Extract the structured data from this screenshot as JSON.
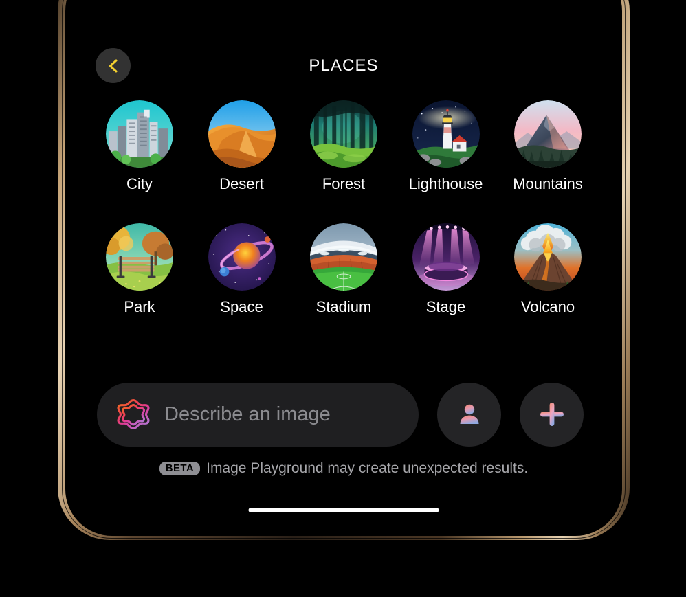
{
  "device": {
    "frame_color": "#c6a478",
    "screen_bg": "#000000"
  },
  "header": {
    "title": "PLACES",
    "back_icon": "chevron-left-icon",
    "back_icon_color": "#F5D130",
    "back_button_bg": "#323232"
  },
  "grid": {
    "rows": [
      [
        {
          "label": "City",
          "art": "city",
          "sky": "#21b3bf",
          "accent": "#c9ced6"
        },
        {
          "label": "Desert",
          "art": "desert",
          "sky": "#2aa8ea",
          "accent": "#e2902f"
        },
        {
          "label": "Forest",
          "art": "forest",
          "sky": "#1d6f6a",
          "accent": "#8fd24a"
        },
        {
          "label": "Lighthouse",
          "art": "lighthouse",
          "sky": "#11203f",
          "accent": "#ffffff"
        },
        {
          "label": "Mountains",
          "art": "mountains",
          "sky": "#f3b8c4",
          "accent": "#4f5f78"
        }
      ],
      [
        {
          "label": "Park",
          "art": "park",
          "sky": "#57bfae",
          "accent": "#d9a24a"
        },
        {
          "label": "Space",
          "art": "space",
          "sky": "#2a1858",
          "accent": "#f0a33c"
        },
        {
          "label": "Stadium",
          "art": "stadium",
          "sky": "#9fb3c4",
          "accent": "#35b33c"
        },
        {
          "label": "Stage",
          "art": "stage",
          "sky": "#2b1d4d",
          "accent": "#e35ed0"
        },
        {
          "label": "Volcano",
          "art": "volcano",
          "sky": "#63b6d8",
          "accent": "#f2a01e"
        }
      ]
    ]
  },
  "composer": {
    "input_placeholder": "Describe an image",
    "input_value": "",
    "apple_intelligence_icon": "apple-intelligence-icon",
    "person_button_icon": "person-icon",
    "add_button_icon": "plus-icon",
    "field_bg": "#1f1f21",
    "button_bg": "#242426"
  },
  "disclaimer": {
    "badge": "BETA",
    "text": "Image Playground may create unexpected results."
  }
}
